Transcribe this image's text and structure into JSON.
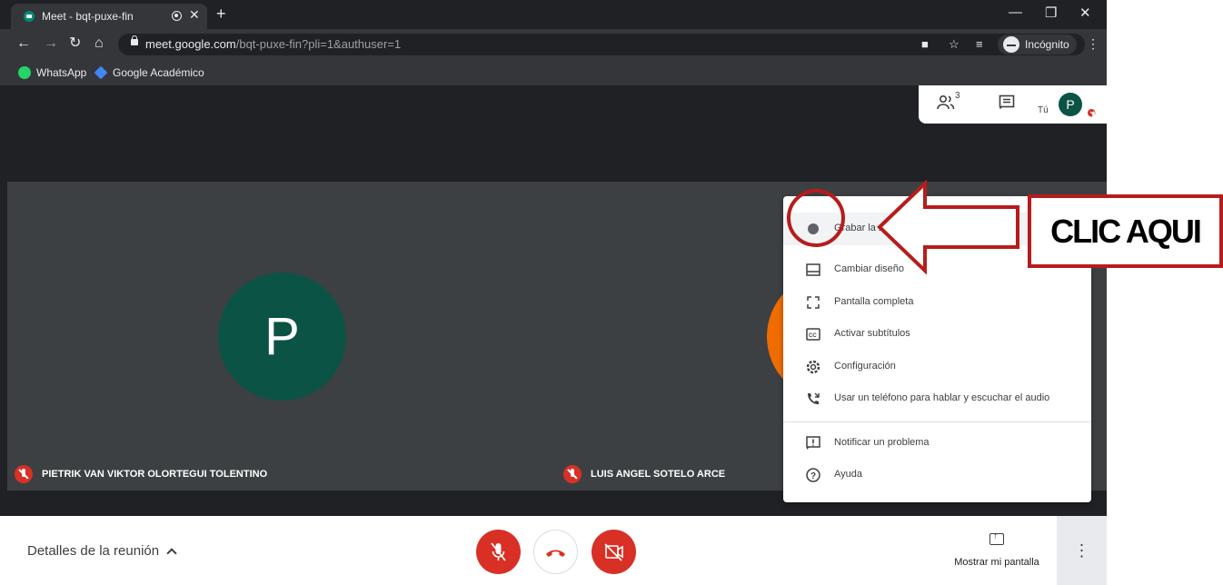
{
  "browser": {
    "tab_title": "Meet - bqt-puxe-fin",
    "url_host": "meet.google.com",
    "url_path": "/bqt-puxe-fin?pli=1&authuser=1",
    "incognito_label": "Incógnito",
    "bookmarks": [
      {
        "label": "WhatsApp",
        "icon": "whatsapp-icon",
        "color": "#25d366"
      },
      {
        "label": "Google Académico",
        "icon": "google-scholar-icon",
        "color": "#4285f4"
      }
    ]
  },
  "meet": {
    "participant_count": "3",
    "you_label": "Tú",
    "self_initial": "P",
    "participants": [
      {
        "initial": "P",
        "name": "PIETRIK VAN VIKTOR OLORTEGUI TOLENTINO",
        "color": "#0b5345",
        "muted": true
      },
      {
        "initial": "",
        "name": "LUIS ANGEL SOTELO ARCE",
        "color": "#ef6c00",
        "muted": true
      }
    ],
    "meeting_details": "Detalles de la reunión",
    "present_label": "Mostrar mi pantalla"
  },
  "menu": {
    "items": [
      {
        "label": "Grabar la reunión",
        "icon": "record-icon"
      },
      {
        "label": "Cambiar diseño",
        "icon": "layout-icon"
      },
      {
        "label": "Pantalla completa",
        "icon": "fullscreen-icon"
      },
      {
        "label": "Activar subtítulos",
        "icon": "captions-icon"
      },
      {
        "label": "Configuración",
        "icon": "settings-icon"
      },
      {
        "label": "Usar un teléfono para hablar y escuchar el audio",
        "icon": "phone-icon"
      },
      {
        "label": "Notificar un problema",
        "icon": "report-icon"
      },
      {
        "label": "Ayuda",
        "icon": "help-icon"
      }
    ]
  },
  "annotation": {
    "text": "CLIC AQUI",
    "color": "#b71c1c"
  }
}
